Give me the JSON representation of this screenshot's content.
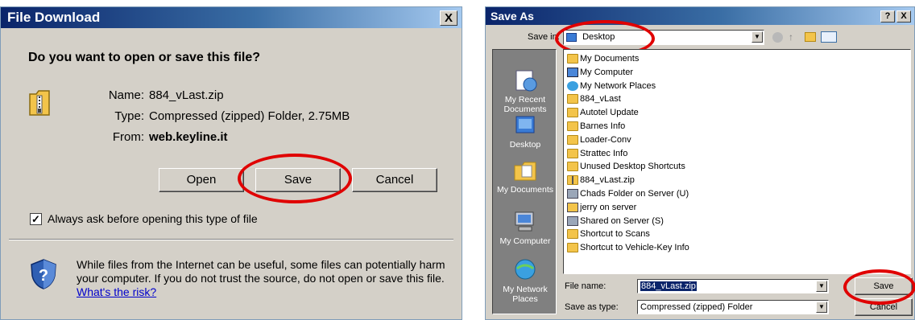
{
  "file_download": {
    "title": "File Download",
    "close_glyph": "X",
    "question": "Do you want to open or save this file?",
    "name_label": "Name:",
    "name_value": "884_vLast.zip",
    "type_label": "Type:",
    "type_value": "Compressed (zipped) Folder, 2.75MB",
    "from_label": "From:",
    "from_value": "web.keyline.it",
    "open_label": "Open",
    "save_label": "Save",
    "cancel_label": "Cancel",
    "checkbox_label": "Always ask before opening this type of file",
    "checkbox_checked": true,
    "warning_text": "While files from the Internet can be useful, some files can potentially harm your computer. If you do not trust the source, do not open or save this file.",
    "risk_link": "What's the risk?"
  },
  "save_as": {
    "title": "Save As",
    "help_glyph": "?",
    "close_glyph": "X",
    "save_in_label": "Save in:",
    "save_in_value": "Desktop",
    "places": [
      {
        "label": "My Recent Documents",
        "icon": "recent-documents-icon"
      },
      {
        "label": "Desktop",
        "icon": "desktop-icon"
      },
      {
        "label": "My Documents",
        "icon": "my-documents-icon"
      },
      {
        "label": "My Computer",
        "icon": "my-computer-icon"
      },
      {
        "label": "My Network Places",
        "icon": "network-places-icon"
      }
    ],
    "files": [
      {
        "name": "My Documents",
        "icon": "my-documents-icon"
      },
      {
        "name": "My Computer",
        "icon": "computer-icon"
      },
      {
        "name": "My Network Places",
        "icon": "network-icon"
      },
      {
        "name": "884_vLast",
        "icon": "folder-icon"
      },
      {
        "name": "Autotel Update",
        "icon": "folder-icon"
      },
      {
        "name": "Barnes Info",
        "icon": "folder-icon"
      },
      {
        "name": "Loader-Conv",
        "icon": "folder-icon"
      },
      {
        "name": "Strattec Info",
        "icon": "folder-icon"
      },
      {
        "name": "Unused Desktop Shortcuts",
        "icon": "folder-icon"
      },
      {
        "name": "884_vLast.zip",
        "icon": "zip-folder-icon"
      },
      {
        "name": "Chads Folder on Server (U)",
        "icon": "network-drive-icon"
      },
      {
        "name": "jerry on server",
        "icon": "shortcut-icon"
      },
      {
        "name": "Shared on Server (S)",
        "icon": "network-drive-icon"
      },
      {
        "name": "Shortcut to Scans",
        "icon": "shortcut-folder-icon"
      },
      {
        "name": "Shortcut to Vehicle-Key Info",
        "icon": "shortcut-folder-icon"
      }
    ],
    "filename_label": "File name:",
    "filename_value": "884_vLast.zip",
    "type_label": "Save as type:",
    "type_value": "Compressed (zipped) Folder",
    "save_label": "Save",
    "cancel_label": "Cancel"
  }
}
